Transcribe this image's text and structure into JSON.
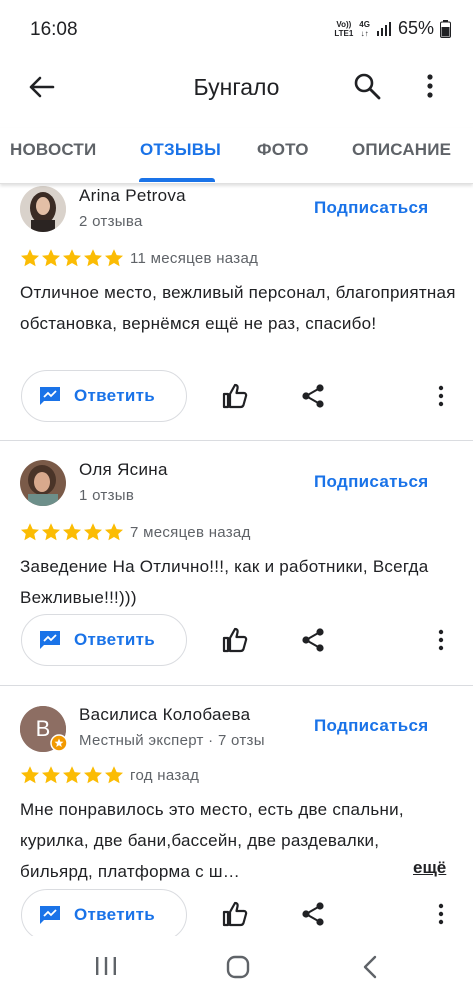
{
  "status_bar": {
    "time": "16:08",
    "volte_top": "Vo))",
    "volte_bottom": "LTE1",
    "network_top": "4G",
    "network_bottom": "↓↑",
    "battery": "65%"
  },
  "app_bar": {
    "title": "Бунгало",
    "icons": [
      "back-arrow-icon",
      "search-icon",
      "more-vert-icon"
    ]
  },
  "tabs": [
    {
      "label": "НОВОСТИ",
      "active": false
    },
    {
      "label": "ОТЗЫВЫ",
      "active": true
    },
    {
      "label": "ФОТО",
      "active": false
    },
    {
      "label": "ОПИСАНИЕ",
      "active": false
    }
  ],
  "colors": {
    "accent": "#1a73e8",
    "star": "#fbbc04",
    "text_primary": "#202124",
    "text_secondary": "#5f6368",
    "divider": "#dadce0",
    "local_guide_badge": "#f29900"
  },
  "reviews": [
    {
      "name": "Arina Petrova",
      "meta": "2 отзыва",
      "subscribe_label": "Подписаться",
      "rating": 5,
      "time_ago": "11 месяцев назад",
      "text": "Отличное место, вежливый персонал, благоприятная обстановка, вернёмся ещё не раз, спасибо!",
      "reply_label": "Ответить"
    },
    {
      "name": "Оля Ясина",
      "meta": "1 отзыв",
      "subscribe_label": "Подписаться",
      "rating": 5,
      "time_ago": "7 месяцев назад",
      "text": "Заведение На Отлично!!!, как и работники, Всегда Вежливые!!!)))",
      "reply_label": "Ответить"
    },
    {
      "name": "Василиса Колобаева",
      "avatar_letter": "В",
      "meta": "Местный эксперт · 7 отзы",
      "subscribe_label": "Подписаться",
      "rating": 5,
      "time_ago": "год назад",
      "text": "Мне понравилось это место, есть две спальни, курилка, две бани,бассейн, две раздевалки, бильярд, платформа с ш…",
      "more_label": "ещё",
      "reply_label": "Ответить"
    }
  ],
  "nav_bar": {
    "icons": [
      "recents-icon",
      "home-icon",
      "back-icon"
    ]
  }
}
